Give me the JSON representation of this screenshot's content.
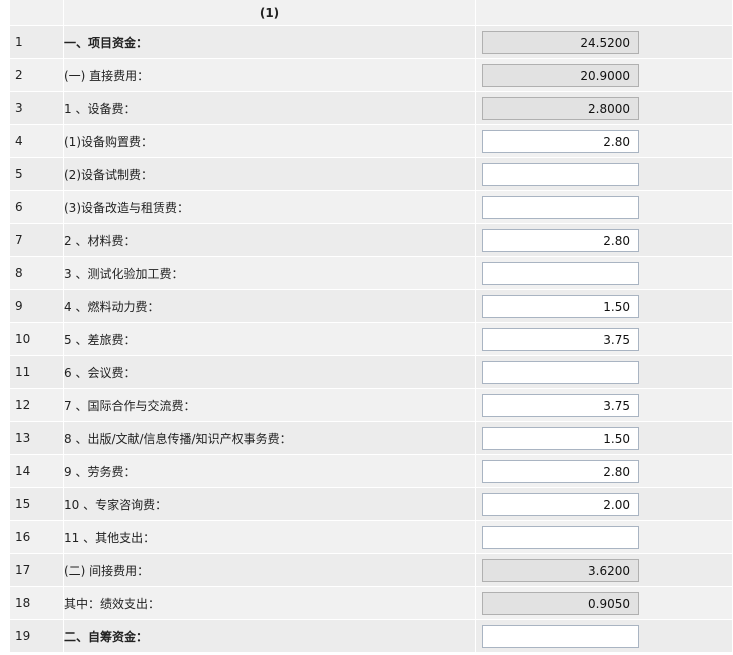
{
  "header": {
    "col_label": "(1)"
  },
  "rows": [
    {
      "num": "1",
      "label": "一、项目资金：",
      "value": "24.5200",
      "type": "ro"
    },
    {
      "num": "2",
      "label": "(一) 直接费用：",
      "value": "20.9000",
      "type": "ro"
    },
    {
      "num": "3",
      "label": "1 、设备费：",
      "value": "2.8000",
      "type": "ro"
    },
    {
      "num": "4",
      "label": "(1)设备购置费：",
      "value": "2.80",
      "type": "in"
    },
    {
      "num": "5",
      "label": "(2)设备试制费：",
      "value": "",
      "type": "in"
    },
    {
      "num": "6",
      "label": "(3)设备改造与租赁费：",
      "value": "",
      "type": "in"
    },
    {
      "num": "7",
      "label": "2 、材料费：",
      "value": "2.80",
      "type": "in"
    },
    {
      "num": "8",
      "label": "3 、测试化验加工费：",
      "value": "",
      "type": "in"
    },
    {
      "num": "9",
      "label": "4 、燃料动力费：",
      "value": "1.50",
      "type": "in"
    },
    {
      "num": "10",
      "label": "5 、差旅费：",
      "value": "3.75",
      "type": "in"
    },
    {
      "num": "11",
      "label": "6 、会议费：",
      "value": "",
      "type": "in"
    },
    {
      "num": "12",
      "label": "7 、国际合作与交流费：",
      "value": "3.75",
      "type": "in"
    },
    {
      "num": "13",
      "label": "8 、出版/文献/信息传播/知识产权事务费：",
      "value": "1.50",
      "type": "in"
    },
    {
      "num": "14",
      "label": "9 、劳务费：",
      "value": "2.80",
      "type": "in"
    },
    {
      "num": "15",
      "label": "10 、专家咨询费：",
      "value": "2.00",
      "type": "in"
    },
    {
      "num": "16",
      "label": "11 、其他支出：",
      "value": "",
      "type": "in"
    },
    {
      "num": "17",
      "label": "(二) 间接费用：",
      "value": "3.6200",
      "type": "ro"
    },
    {
      "num": "18",
      "label": "其中：绩效支出：",
      "value": "0.9050",
      "type": "ro"
    },
    {
      "num": "19",
      "label": "二、自筹资金：",
      "value": "",
      "type": "in"
    }
  ]
}
